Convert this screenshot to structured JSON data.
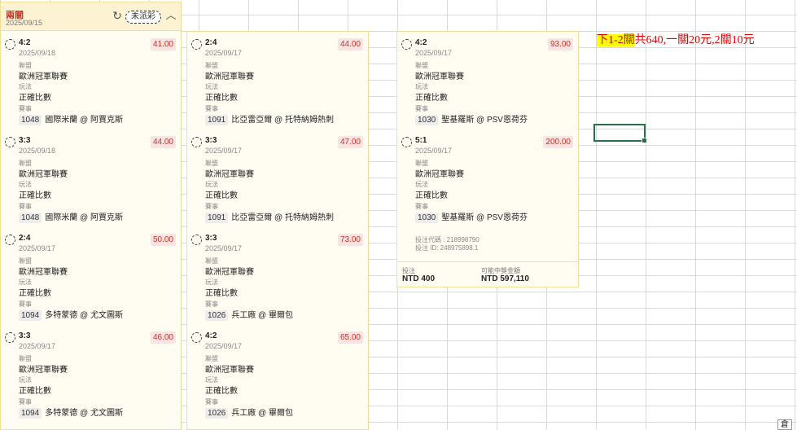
{
  "header": {
    "title": "兩關",
    "date": "2025/09/15",
    "status": "未派彩"
  },
  "labels": {
    "league": "聯盟",
    "playtype": "玩法",
    "match": "賽事"
  },
  "columns": [
    {
      "bets": [
        {
          "score": "4:2",
          "date": "2025/09/18",
          "odds": "41.00",
          "league": "歐洲冠軍聯賽",
          "playtype": "正確比數",
          "match_id": "1048",
          "match": "國際米蘭 @ 阿賈克斯"
        },
        {
          "score": "3:3",
          "date": "2025/09/18",
          "odds": "44.00",
          "league": "歐洲冠軍聯賽",
          "playtype": "正確比數",
          "match_id": "1048",
          "match": "國際米蘭 @ 阿賈克斯"
        },
        {
          "score": "2:4",
          "date": "2025/09/17",
          "odds": "50.00",
          "league": "歐洲冠軍聯賽",
          "playtype": "正確比數",
          "match_id": "1094",
          "match": "多特蒙德 @ 尤文圖斯"
        },
        {
          "score": "3:3",
          "date": "2025/09/17",
          "odds": "46.00",
          "league": "歐洲冠軍聯賽",
          "playtype": "正確比數",
          "match_id": "1094",
          "match": "多特蒙德 @ 尤文圖斯"
        }
      ]
    },
    {
      "bets": [
        {
          "score": "2:4",
          "date": "2025/09/17",
          "odds": "44.00",
          "league": "歐洲冠軍聯賽",
          "playtype": "正確比數",
          "match_id": "1091",
          "match": "比亞雷亞爾 @ 托特納姆熱刺"
        },
        {
          "score": "3:3",
          "date": "2025/09/17",
          "odds": "47.00",
          "league": "歐洲冠軍聯賽",
          "playtype": "正確比數",
          "match_id": "1091",
          "match": "比亞雷亞爾 @ 托特納姆熱刺"
        },
        {
          "score": "3:3",
          "date": "2025/09/17",
          "odds": "73.00",
          "league": "歐洲冠軍聯賽",
          "playtype": "正確比數",
          "match_id": "1026",
          "match": "兵工廠 @ 畢爾包"
        },
        {
          "score": "4:2",
          "date": "2025/09/17",
          "odds": "65.00",
          "league": "歐洲冠軍聯賽",
          "playtype": "正確比數",
          "match_id": "1026",
          "match": "兵工廠 @ 畢爾包"
        }
      ]
    },
    {
      "bets": [
        {
          "score": "4:2",
          "date": "2025/09/17",
          "odds": "93.00",
          "league": "歐洲冠軍聯賽",
          "playtype": "正確比數",
          "match_id": "1030",
          "match": "聖基羅斯 @ PSV恩荷芬"
        },
        {
          "score": "5:1",
          "date": "2025/09/17",
          "odds": "200.00",
          "league": "歐洲冠軍聯賽",
          "playtype": "正確比數",
          "match_id": "1030",
          "match": "聖基羅斯 @ PSV恩荷芬"
        }
      ],
      "bet_code": "投注代碼 : 218998790",
      "bet_id": "投注 ID: 248975898.1",
      "stake_label": "投注",
      "stake": "NTD 400",
      "payout_label": "可能中獎金額",
      "payout": "NTD 597,110"
    }
  ],
  "note": {
    "highlight": "下1-2關",
    "rest": "共640,一關20元,2關10元"
  },
  "sheet_tab": "倉"
}
